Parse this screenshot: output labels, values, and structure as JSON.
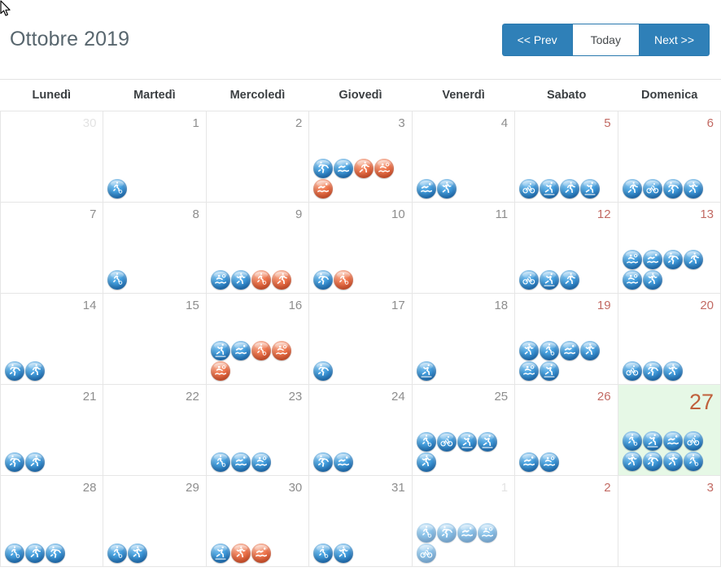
{
  "header": {
    "title": "Ottobre 2019",
    "buttons": {
      "prev": "<< Prev",
      "today": "Today",
      "next": "Next >>"
    }
  },
  "colors": {
    "accent_blue": "#2f80b8",
    "weekend_red": "#c26a63",
    "today_bg": "#e6f8e6",
    "today_number": "#c0603c",
    "daynum_gray": "#8d8d8d",
    "other_month_gray": "#e3e3e3",
    "grid_border": "#e6e6e6",
    "icon_blue": "#1f73bd",
    "icon_orange": "#dd522a"
  },
  "weekdays": [
    "Lunedì",
    "Martedì",
    "Mercoledì",
    "Giovedì",
    "Venerdì",
    "Sabato",
    "Domenica"
  ],
  "weeks": [
    [
      {
        "day": "30",
        "other_month": true,
        "weekend": false,
        "today": false,
        "icons": []
      },
      {
        "day": "1",
        "other_month": false,
        "weekend": false,
        "today": false,
        "icons": [
          {
            "color": "blue",
            "name": "sport-soccer-icon"
          }
        ]
      },
      {
        "day": "2",
        "other_month": false,
        "weekend": false,
        "today": false,
        "icons": []
      },
      {
        "day": "3",
        "other_month": false,
        "weekend": false,
        "today": false,
        "icons": [
          {
            "color": "blue",
            "name": "sport-gymnastics-icon"
          },
          {
            "color": "blue",
            "name": "sport-swimming-icon"
          },
          {
            "color": "orange",
            "name": "sport-running-icon"
          },
          {
            "color": "orange",
            "name": "sport-waterpolo-icon"
          },
          {
            "color": "orange",
            "name": "sport-swimming-icon"
          }
        ]
      },
      {
        "day": "4",
        "other_month": false,
        "weekend": false,
        "today": false,
        "icons": [
          {
            "color": "blue",
            "name": "sport-swimming-icon"
          },
          {
            "color": "blue",
            "name": "sport-dance-icon"
          }
        ]
      },
      {
        "day": "5",
        "other_month": false,
        "weekend": true,
        "today": false,
        "icons": [
          {
            "color": "blue",
            "name": "sport-cycling-icon"
          },
          {
            "color": "blue",
            "name": "sport-skating-icon"
          },
          {
            "color": "blue",
            "name": "sport-running-icon"
          },
          {
            "color": "blue",
            "name": "sport-skating-icon"
          }
        ]
      },
      {
        "day": "6",
        "other_month": false,
        "weekend": true,
        "today": false,
        "icons": [
          {
            "color": "blue",
            "name": "sport-running-icon"
          },
          {
            "color": "blue",
            "name": "sport-cycling-icon"
          },
          {
            "color": "blue",
            "name": "sport-gymnastics-icon"
          },
          {
            "color": "blue",
            "name": "sport-dance-icon"
          }
        ]
      }
    ],
    [
      {
        "day": "7",
        "other_month": false,
        "weekend": false,
        "today": false,
        "icons": []
      },
      {
        "day": "8",
        "other_month": false,
        "weekend": false,
        "today": false,
        "icons": [
          {
            "color": "blue",
            "name": "sport-soccer-icon"
          }
        ]
      },
      {
        "day": "9",
        "other_month": false,
        "weekend": false,
        "today": false,
        "icons": [
          {
            "color": "blue",
            "name": "sport-waterpolo-icon"
          },
          {
            "color": "blue",
            "name": "sport-dance-icon"
          },
          {
            "color": "orange",
            "name": "sport-soccer-icon"
          },
          {
            "color": "orange",
            "name": "sport-running-icon"
          }
        ]
      },
      {
        "day": "10",
        "other_month": false,
        "weekend": false,
        "today": false,
        "icons": [
          {
            "color": "blue",
            "name": "sport-gymnastics-icon"
          },
          {
            "color": "orange",
            "name": "sport-soccer-icon"
          }
        ]
      },
      {
        "day": "11",
        "other_month": false,
        "weekend": false,
        "today": false,
        "icons": []
      },
      {
        "day": "12",
        "other_month": false,
        "weekend": true,
        "today": false,
        "icons": [
          {
            "color": "blue",
            "name": "sport-cycling-icon"
          },
          {
            "color": "blue",
            "name": "sport-skating-icon"
          },
          {
            "color": "blue",
            "name": "sport-running-icon"
          }
        ]
      },
      {
        "day": "13",
        "other_month": false,
        "weekend": true,
        "today": false,
        "icons": [
          {
            "color": "blue",
            "name": "sport-waterpolo-icon"
          },
          {
            "color": "blue",
            "name": "sport-swimming-icon"
          },
          {
            "color": "blue",
            "name": "sport-gymnastics-icon"
          },
          {
            "color": "blue",
            "name": "sport-running-icon"
          },
          {
            "color": "blue",
            "name": "sport-waterpolo-icon"
          },
          {
            "color": "blue",
            "name": "sport-dance-icon"
          }
        ]
      }
    ],
    [
      {
        "day": "14",
        "other_month": false,
        "weekend": false,
        "today": false,
        "icons": [
          {
            "color": "blue",
            "name": "sport-gymnastics-icon"
          },
          {
            "color": "blue",
            "name": "sport-running-icon"
          }
        ]
      },
      {
        "day": "15",
        "other_month": false,
        "weekend": false,
        "today": false,
        "icons": []
      },
      {
        "day": "16",
        "other_month": false,
        "weekend": false,
        "today": false,
        "icons": [
          {
            "color": "blue",
            "name": "sport-skating-icon"
          },
          {
            "color": "blue",
            "name": "sport-swimming-icon"
          },
          {
            "color": "orange",
            "name": "sport-soccer-icon"
          },
          {
            "color": "orange",
            "name": "sport-waterpolo-icon"
          },
          {
            "color": "orange",
            "name": "sport-waterpolo-icon"
          }
        ]
      },
      {
        "day": "17",
        "other_month": false,
        "weekend": false,
        "today": false,
        "icons": [
          {
            "color": "blue",
            "name": "sport-gymnastics-icon"
          }
        ]
      },
      {
        "day": "18",
        "other_month": false,
        "weekend": false,
        "today": false,
        "icons": [
          {
            "color": "blue",
            "name": "sport-skating-icon"
          }
        ]
      },
      {
        "day": "19",
        "other_month": false,
        "weekend": true,
        "today": false,
        "icons": [
          {
            "color": "blue",
            "name": "sport-dance-icon"
          },
          {
            "color": "blue",
            "name": "sport-soccer-icon"
          },
          {
            "color": "blue",
            "name": "sport-swimming-icon"
          },
          {
            "color": "blue",
            "name": "sport-dance-icon"
          },
          {
            "color": "blue",
            "name": "sport-waterpolo-icon"
          },
          {
            "color": "blue",
            "name": "sport-skating-icon"
          }
        ]
      },
      {
        "day": "20",
        "other_month": false,
        "weekend": true,
        "today": false,
        "icons": [
          {
            "color": "blue",
            "name": "sport-cycling-icon"
          },
          {
            "color": "blue",
            "name": "sport-gymnastics-icon"
          },
          {
            "color": "blue",
            "name": "sport-dance-icon"
          }
        ]
      }
    ],
    [
      {
        "day": "21",
        "other_month": false,
        "weekend": false,
        "today": false,
        "icons": [
          {
            "color": "blue",
            "name": "sport-gymnastics-icon"
          },
          {
            "color": "blue",
            "name": "sport-running-icon"
          }
        ]
      },
      {
        "day": "22",
        "other_month": false,
        "weekend": false,
        "today": false,
        "icons": []
      },
      {
        "day": "23",
        "other_month": false,
        "weekend": false,
        "today": false,
        "icons": [
          {
            "color": "blue",
            "name": "sport-soccer-icon"
          },
          {
            "color": "blue",
            "name": "sport-swimming-icon"
          },
          {
            "color": "blue",
            "name": "sport-waterpolo-icon"
          }
        ]
      },
      {
        "day": "24",
        "other_month": false,
        "weekend": false,
        "today": false,
        "icons": [
          {
            "color": "blue",
            "name": "sport-gymnastics-icon"
          },
          {
            "color": "blue",
            "name": "sport-swimming-icon"
          }
        ]
      },
      {
        "day": "25",
        "other_month": false,
        "weekend": false,
        "today": false,
        "icons": [
          {
            "color": "blue",
            "name": "sport-soccer-icon"
          },
          {
            "color": "blue",
            "name": "sport-cycling-icon"
          },
          {
            "color": "blue",
            "name": "sport-skating-icon"
          },
          {
            "color": "blue",
            "name": "sport-skating-icon"
          },
          {
            "color": "blue",
            "name": "sport-dance-icon"
          }
        ]
      },
      {
        "day": "26",
        "other_month": false,
        "weekend": true,
        "today": false,
        "icons": [
          {
            "color": "blue",
            "name": "sport-swimming-icon"
          },
          {
            "color": "blue",
            "name": "sport-waterpolo-icon"
          }
        ]
      },
      {
        "day": "27",
        "other_month": false,
        "weekend": true,
        "today": true,
        "icons": [
          {
            "color": "blue",
            "name": "sport-soccer-icon"
          },
          {
            "color": "blue",
            "name": "sport-skating-icon"
          },
          {
            "color": "blue",
            "name": "sport-swimming-icon"
          },
          {
            "color": "blue",
            "name": "sport-cycling-icon"
          },
          {
            "color": "blue",
            "name": "sport-dance-icon"
          },
          {
            "color": "blue",
            "name": "sport-gymnastics-icon"
          },
          {
            "color": "blue",
            "name": "sport-dance-icon"
          },
          {
            "color": "blue",
            "name": "sport-soccer-icon"
          }
        ]
      }
    ],
    [
      {
        "day": "28",
        "other_month": false,
        "weekend": false,
        "today": false,
        "icons": [
          {
            "color": "blue",
            "name": "sport-soccer-icon"
          },
          {
            "color": "blue",
            "name": "sport-running-icon"
          },
          {
            "color": "blue",
            "name": "sport-gymnastics-icon"
          }
        ]
      },
      {
        "day": "29",
        "other_month": false,
        "weekend": false,
        "today": false,
        "icons": [
          {
            "color": "blue",
            "name": "sport-soccer-icon"
          },
          {
            "color": "blue",
            "name": "sport-dance-icon"
          }
        ]
      },
      {
        "day": "30",
        "other_month": false,
        "weekend": false,
        "today": false,
        "icons": [
          {
            "color": "blue",
            "name": "sport-skating-icon"
          },
          {
            "color": "orange",
            "name": "sport-dance-icon"
          },
          {
            "color": "orange",
            "name": "sport-swimming-icon"
          }
        ]
      },
      {
        "day": "31",
        "other_month": false,
        "weekend": false,
        "today": false,
        "icons": [
          {
            "color": "blue",
            "name": "sport-soccer-icon"
          },
          {
            "color": "blue",
            "name": "sport-dance-icon"
          }
        ]
      },
      {
        "day": "1",
        "other_month": true,
        "weekend": false,
        "today": false,
        "icons": [
          {
            "color": "blue",
            "name": "sport-soccer-icon"
          },
          {
            "color": "blue",
            "name": "sport-gymnastics-icon"
          },
          {
            "color": "blue",
            "name": "sport-swimming-icon"
          },
          {
            "color": "blue",
            "name": "sport-waterpolo-icon"
          },
          {
            "color": "blue",
            "name": "sport-cycling-icon"
          }
        ]
      },
      {
        "day": "2",
        "other_month": true,
        "weekend": true,
        "today": false,
        "icons": []
      },
      {
        "day": "3",
        "other_month": true,
        "weekend": true,
        "today": false,
        "icons": []
      }
    ]
  ]
}
